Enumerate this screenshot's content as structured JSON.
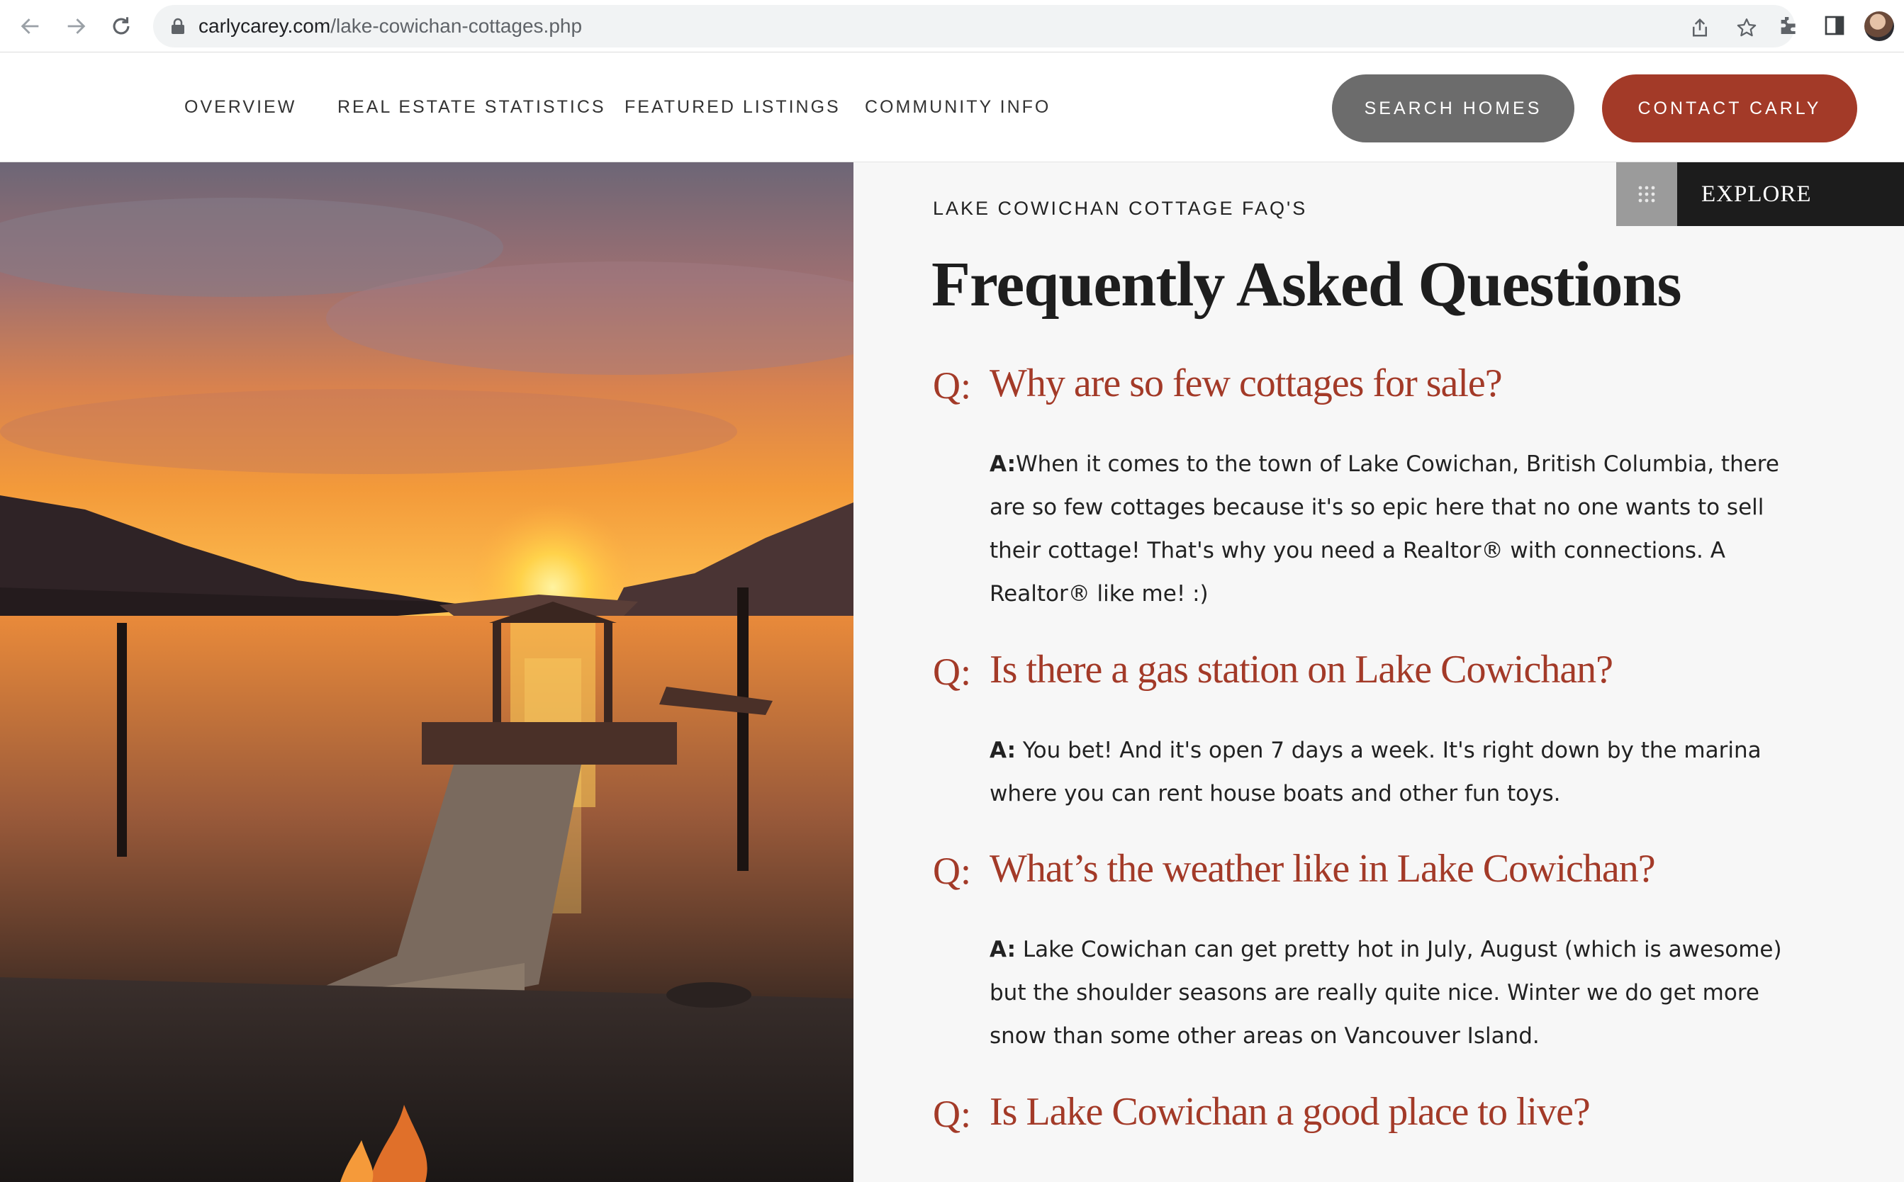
{
  "browser": {
    "url_domain": "carlycarey.com",
    "url_path": "/lake-cowichan-cottages.php",
    "icons": [
      "back-arrow-icon",
      "forward-arrow-icon",
      "reload-icon",
      "lock-icon",
      "share-icon",
      "star-icon",
      "extensions-icon",
      "sidebar-icon",
      "profile-avatar"
    ]
  },
  "nav": {
    "links": [
      "OVERVIEW",
      "REAL ESTATE STATISTICS",
      "FEATURED LISTINGS",
      "COMMUNITY INFO"
    ],
    "search_button": "SEARCH HOMES",
    "contact_button": "CONTACT CARLY"
  },
  "explore": {
    "label": "EXPLORE",
    "icon": "grid-dots-icon"
  },
  "faq": {
    "eyebrow": "LAKE COWICHAN COTTAGE FAQ'S",
    "heading": "Frequently Asked Questions",
    "items": [
      {
        "prefix": "Q:",
        "question": "Why are so few cottages for sale?",
        "answer_label": "A:",
        "answer": "When it comes to the town of Lake Cowichan, British Columbia, there are so few cottages because it's so epic here that no one wants to sell their cottage! That's why you need a Realtor® with connections. A Realtor® like me! :)"
      },
      {
        "prefix": "Q:",
        "question": "Is there a gas station on Lake Cowichan?",
        "answer_label": "A:",
        "answer": " You bet! And it's open 7 days a week. It's right down by the marina where you can rent house boats and other fun toys."
      },
      {
        "prefix": "Q:",
        "question": "What’s the weather like in Lake Cowichan?",
        "answer_label": "A:",
        "answer": " Lake Cowichan can get pretty hot in July, August (which is awesome) but the shoulder seasons are really quite nice. Winter we do get more snow than some other areas on Vancouver Island."
      },
      {
        "prefix": "Q:",
        "question": "Is Lake Cowichan a good place to live?"
      }
    ]
  },
  "colors": {
    "accent": "#a33a28",
    "search_button": "#6c6c6c",
    "explore_bg": "#1c1c1c"
  }
}
